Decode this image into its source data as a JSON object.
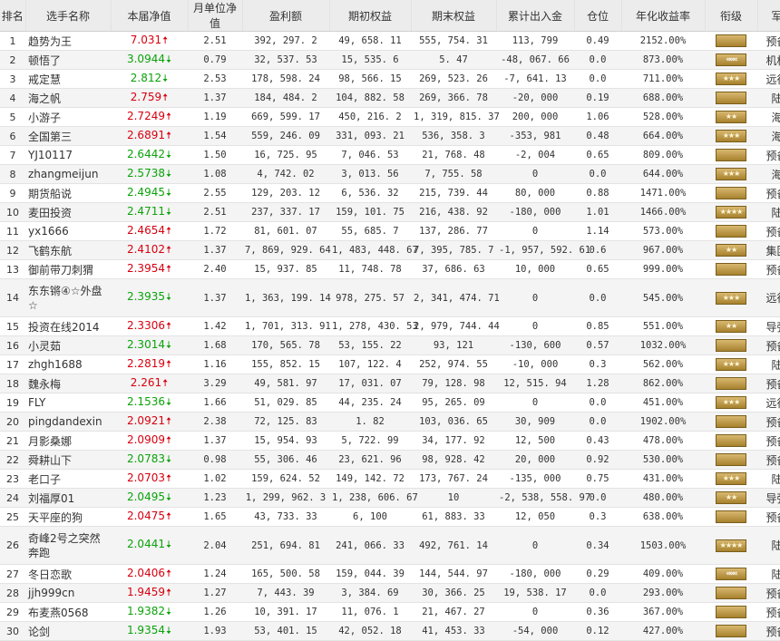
{
  "headers": [
    "排名",
    "选手名称",
    "本届净值",
    "月单位净值",
    "盈利额",
    "期初权益",
    "期末权益",
    "累计出入金",
    "仓位",
    "年化收益率",
    "衔级",
    "军种"
  ],
  "rows": [
    {
      "rank": "1",
      "name": "趋势为王",
      "nav": "7.031",
      "dir": "up",
      "unit": "2.51",
      "profit": "392, 297. 2",
      "init": "49, 658. 11",
      "end": "555, 754. 31",
      "flow": "113, 799",
      "pos": "0.49",
      "ann": "2152.00%",
      "badge": "bar",
      "army": "预备役"
    },
    {
      "rank": "2",
      "name": "顿悟了",
      "nav": "3.0944",
      "dir": "down",
      "unit": "0.79",
      "profit": "32, 537. 53",
      "init": "15, 535. 6",
      "end": "5. 47",
      "flow": "-48, 067. 66",
      "pos": "0.0",
      "ann": "873.00%",
      "badge": "chev",
      "army": "机枪手"
    },
    {
      "rank": "3",
      "name": "戒定慧",
      "nav": "2.812",
      "dir": "down",
      "unit": "2.53",
      "profit": "178, 598. 24",
      "init": "98, 566. 15",
      "end": "269, 523. 26",
      "flow": "-7, 641. 13",
      "pos": "0.0",
      "ann": "711.00%",
      "badge": "star3",
      "army": "远征军"
    },
    {
      "rank": "4",
      "name": "海之帆",
      "nav": "2.759",
      "dir": "up",
      "unit": "1.37",
      "profit": "184, 484. 2",
      "init": "104, 882. 58",
      "end": "269, 366. 78",
      "flow": "-20, 000",
      "pos": "0.19",
      "ann": "688.00%",
      "badge": "bar",
      "army": "陆军"
    },
    {
      "rank": "5",
      "name": "小游子",
      "nav": "2.7249",
      "dir": "up",
      "unit": "1.19",
      "profit": "669, 599. 17",
      "init": "450, 216. 2",
      "end": "1, 319, 815. 37",
      "flow": "200, 000",
      "pos": "1.06",
      "ann": "528.00%",
      "badge": "star2",
      "army": "海军"
    },
    {
      "rank": "6",
      "name": "全国第三",
      "nav": "2.6891",
      "dir": "up",
      "unit": "1.54",
      "profit": "559, 246. 09",
      "init": "331, 093. 21",
      "end": "536, 358. 3",
      "flow": "-353, 981",
      "pos": "0.48",
      "ann": "664.00%",
      "badge": "star3",
      "army": "海军"
    },
    {
      "rank": "7",
      "name": "YJ10117",
      "nav": "2.6442",
      "dir": "down",
      "unit": "1.50",
      "profit": "16, 725. 95",
      "init": "7, 046. 53",
      "end": "21, 768. 48",
      "flow": "-2, 004",
      "pos": "0.65",
      "ann": "809.00%",
      "badge": "bar",
      "army": "预备役"
    },
    {
      "rank": "8",
      "name": "zhangmeijun",
      "nav": "2.5738",
      "dir": "down",
      "unit": "1.08",
      "profit": "4, 742. 02",
      "init": "3, 013. 56",
      "end": "7, 755. 58",
      "flow": "0",
      "pos": "0.0",
      "ann": "644.00%",
      "badge": "star3",
      "army": "海军"
    },
    {
      "rank": "9",
      "name": "期货船说",
      "nav": "2.4945",
      "dir": "down",
      "unit": "2.55",
      "profit": "129, 203. 12",
      "init": "6, 536. 32",
      "end": "215, 739. 44",
      "flow": "80, 000",
      "pos": "0.88",
      "ann": "1471.00%",
      "badge": "bar",
      "army": "预备役"
    },
    {
      "rank": "10",
      "name": "麦田投资",
      "nav": "2.4711",
      "dir": "down",
      "unit": "2.51",
      "profit": "237, 337. 17",
      "init": "159, 101. 75",
      "end": "216, 438. 92",
      "flow": "-180, 000",
      "pos": "1.01",
      "ann": "1466.00%",
      "badge": "star4",
      "army": "陆军"
    },
    {
      "rank": "11",
      "name": "yx1666",
      "nav": "2.4654",
      "dir": "up",
      "unit": "1.72",
      "profit": "81, 601. 07",
      "init": "55, 685. 7",
      "end": "137, 286. 77",
      "flow": "0",
      "pos": "1.14",
      "ann": "573.00%",
      "badge": "bar",
      "army": "预备役"
    },
    {
      "rank": "12",
      "name": "飞鹤东航",
      "nav": "2.4102",
      "dir": "up",
      "unit": "1.37",
      "profit": "7, 869, 929. 64",
      "init": "1, 483, 448. 67",
      "end": "7, 395, 785. 7",
      "flow": "-1, 957, 592. 61",
      "pos": "0.6",
      "ann": "967.00%",
      "badge": "star2",
      "army": "集团军"
    },
    {
      "rank": "13",
      "name": "御前带刀刺猬",
      "nav": "2.3954",
      "dir": "up",
      "unit": "2.40",
      "profit": "15, 937. 85",
      "init": "11, 748. 78",
      "end": "37, 686. 63",
      "flow": "10, 000",
      "pos": "0.65",
      "ann": "999.00%",
      "badge": "bar",
      "army": "预备役"
    },
    {
      "rank": "14",
      "name": "东东锵④☆外盘☆",
      "nav": "2.3935",
      "dir": "down",
      "unit": "1.37",
      "profit": "1, 363, 199. 14",
      "init": "978, 275. 57",
      "end": "2, 341, 474. 71",
      "flow": "0",
      "pos": "0.0",
      "ann": "545.00%",
      "badge": "star3",
      "army": "远征军",
      "tall": true
    },
    {
      "rank": "15",
      "name": "投资在线2014",
      "nav": "2.3306",
      "dir": "up",
      "unit": "1.42",
      "profit": "1, 701, 313. 91",
      "init": "1, 278, 430. 53",
      "end": "2, 979, 744. 44",
      "flow": "0",
      "pos": "0.85",
      "ann": "551.00%",
      "badge": "star2",
      "army": "导弹部"
    },
    {
      "rank": "16",
      "name": "小灵茹",
      "nav": "2.3014",
      "dir": "down",
      "unit": "1.68",
      "profit": "170, 565. 78",
      "init": "53, 155. 22",
      "end": "93, 121",
      "flow": "-130, 600",
      "pos": "0.57",
      "ann": "1032.00%",
      "badge": "bar",
      "army": "预备役"
    },
    {
      "rank": "17",
      "name": "zhgh1688",
      "nav": "2.2819",
      "dir": "up",
      "unit": "1.16",
      "profit": "155, 852. 15",
      "init": "107, 122. 4",
      "end": "252, 974. 55",
      "flow": "-10, 000",
      "pos": "0.3",
      "ann": "562.00%",
      "badge": "star3",
      "army": "陆军"
    },
    {
      "rank": "18",
      "name": "魏永梅",
      "nav": "2.261",
      "dir": "up",
      "unit": "3.29",
      "profit": "49, 581. 97",
      "init": "17, 031. 07",
      "end": "79, 128. 98",
      "flow": "12, 515. 94",
      "pos": "1.28",
      "ann": "862.00%",
      "badge": "bar",
      "army": "预备役"
    },
    {
      "rank": "19",
      "name": "FLY",
      "nav": "2.1536",
      "dir": "down",
      "unit": "1.66",
      "profit": "51, 029. 85",
      "init": "44, 235. 24",
      "end": "95, 265. 09",
      "flow": "0",
      "pos": "0.0",
      "ann": "451.00%",
      "badge": "star3",
      "army": "远征军"
    },
    {
      "rank": "20",
      "name": "pingdandexin",
      "nav": "2.0921",
      "dir": "up",
      "unit": "2.38",
      "profit": "72, 125. 83",
      "init": "1. 82",
      "end": "103, 036. 65",
      "flow": "30, 909",
      "pos": "0.0",
      "ann": "1902.00%",
      "badge": "bar",
      "army": "预备役"
    },
    {
      "rank": "21",
      "name": "月影桑娜",
      "nav": "2.0909",
      "dir": "up",
      "unit": "1.37",
      "profit": "15, 954. 93",
      "init": "5, 722. 99",
      "end": "34, 177. 92",
      "flow": "12, 500",
      "pos": "0.43",
      "ann": "478.00%",
      "badge": "bar",
      "army": "预备役"
    },
    {
      "rank": "22",
      "name": "舜耕山下",
      "nav": "2.0783",
      "dir": "down",
      "unit": "0.98",
      "profit": "55, 306. 46",
      "init": "23, 621. 96",
      "end": "98, 928. 42",
      "flow": "20, 000",
      "pos": "0.92",
      "ann": "530.00%",
      "badge": "bar",
      "army": "预备役"
    },
    {
      "rank": "23",
      "name": "老口子",
      "nav": "2.0703",
      "dir": "up",
      "unit": "1.02",
      "profit": "159, 624. 52",
      "init": "149, 142. 72",
      "end": "173, 767. 24",
      "flow": "-135, 000",
      "pos": "0.75",
      "ann": "431.00%",
      "badge": "star3",
      "army": "陆军"
    },
    {
      "rank": "24",
      "name": "刘福厚01",
      "nav": "2.0495",
      "dir": "down",
      "unit": "1.23",
      "profit": "1, 299, 962. 3",
      "init": "1, 238, 606. 67",
      "end": "10",
      "flow": "-2, 538, 558. 97",
      "pos": "0.0",
      "ann": "480.00%",
      "badge": "star2",
      "army": "导弹部"
    },
    {
      "rank": "25",
      "name": "天平座的狗",
      "nav": "2.0475",
      "dir": "up",
      "unit": "1.65",
      "profit": "43, 733. 33",
      "init": "6, 100",
      "end": "61, 883. 33",
      "flow": "12, 050",
      "pos": "0.3",
      "ann": "638.00%",
      "badge": "bar",
      "army": "预备役"
    },
    {
      "rank": "26",
      "name": "奇峰2号之突然奔跑",
      "nav": "2.0441",
      "dir": "down",
      "unit": "2.04",
      "profit": "251, 694. 81",
      "init": "241, 066. 33",
      "end": "492, 761. 14",
      "flow": "0",
      "pos": "0.34",
      "ann": "1503.00%",
      "badge": "star4",
      "army": "陆军",
      "tall": true
    },
    {
      "rank": "27",
      "name": "冬日恋歌",
      "nav": "2.0406",
      "dir": "up",
      "unit": "1.24",
      "profit": "165, 500. 58",
      "init": "159, 044. 39",
      "end": "144, 544. 97",
      "flow": "-180, 000",
      "pos": "0.29",
      "ann": "409.00%",
      "badge": "chev",
      "army": "陆军"
    },
    {
      "rank": "28",
      "name": "jjh999cn",
      "nav": "1.9459",
      "dir": "up",
      "unit": "1.27",
      "profit": "7, 443. 39",
      "init": "3, 384. 69",
      "end": "30, 366. 25",
      "flow": "19, 538. 17",
      "pos": "0.0",
      "ann": "293.00%",
      "badge": "bar",
      "army": "预备役"
    },
    {
      "rank": "29",
      "name": "布麦燕0568",
      "nav": "1.9382",
      "dir": "down",
      "unit": "1.26",
      "profit": "10, 391. 17",
      "init": "11, 076. 1",
      "end": "21, 467. 27",
      "flow": "0",
      "pos": "0.36",
      "ann": "367.00%",
      "badge": "bar",
      "army": "预备役"
    },
    {
      "rank": "30",
      "name": "论剑",
      "nav": "1.9354",
      "dir": "down",
      "unit": "1.93",
      "profit": "53, 401. 15",
      "init": "42, 052. 18",
      "end": "41, 453. 33",
      "flow": "-54, 000",
      "pos": "0.12",
      "ann": "427.00%",
      "badge": "bar",
      "army": "预备役"
    }
  ],
  "colors": {
    "up": "#d7000f",
    "down": "#0aa30a"
  },
  "arrows": {
    "up": "🠅",
    "down": "🠇"
  },
  "badge_glyphs": {
    "bar": "",
    "chev": "«««",
    "star2": "★★",
    "star3": "★★★",
    "star4": "★★★★"
  }
}
